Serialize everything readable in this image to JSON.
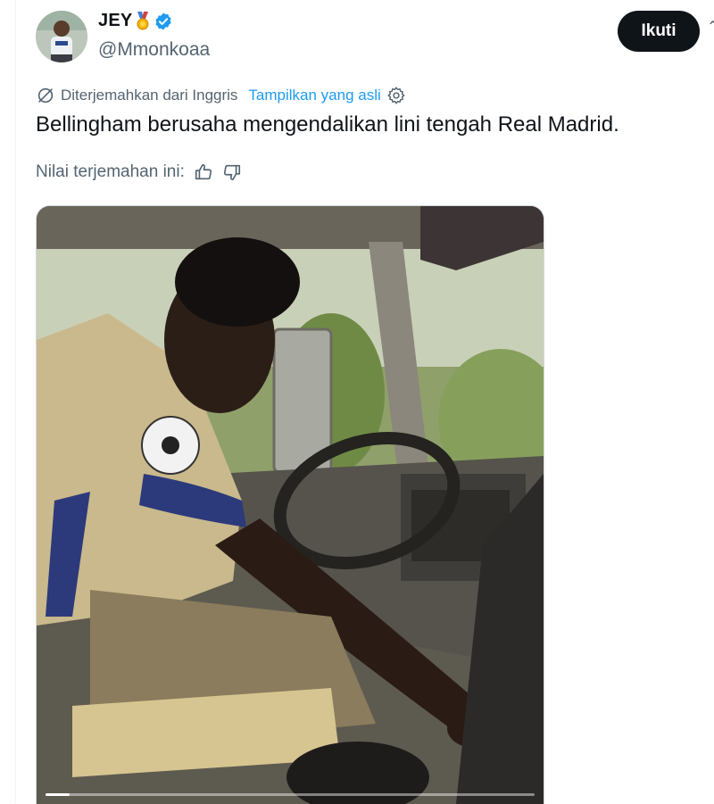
{
  "author": {
    "display_name": "JEY",
    "handle": "@Mmonkoaa",
    "badges": [
      "medal-icon",
      "verified-icon"
    ]
  },
  "follow_button": {
    "label": "Ikuti"
  },
  "translation": {
    "notice": "Diterjemahkan dari Inggris",
    "show_original": "Tampilkan yang asli"
  },
  "tweet": {
    "text": "Bellingham berusaha mengendalikan lini tengah Real Madrid."
  },
  "rating": {
    "label": "Nilai terjemahan ini:"
  },
  "media": {
    "type": "video",
    "progress_fraction": 0.05
  },
  "colors": {
    "accent": "#1d9bf0",
    "text_primary": "#0f1419",
    "text_secondary": "#536471",
    "button_bg": "#0f1419"
  }
}
